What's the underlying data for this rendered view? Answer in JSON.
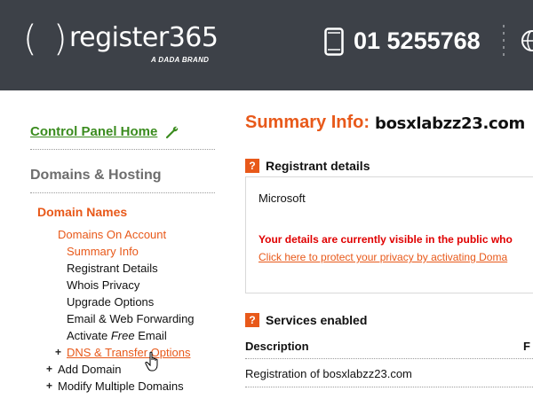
{
  "header": {
    "logo": {
      "open_paren": "(",
      "close_paren": ")",
      "name": "register365",
      "tagline": "A DADA BRAND"
    },
    "phone_icon": "phone-icon",
    "phone_number": "01 5255768",
    "globe_icon": "globe-icon",
    "bg_color": "#3d4148"
  },
  "sidebar": {
    "control_panel_home": "Control Panel Home",
    "wrench_icon": "wrench-icon",
    "domains_hosting": "Domains & Hosting",
    "domain_names": "Domain Names",
    "domains_on_account": "Domains On Account",
    "items": [
      {
        "label": "Summary Info"
      },
      {
        "label": "Registrant Details"
      },
      {
        "label": "Whois Privacy"
      },
      {
        "label": "Upgrade Options"
      },
      {
        "label": "Email & Web Forwarding"
      },
      {
        "label_pre": "Activate ",
        "label_em": "Free",
        "label_post": " Email"
      }
    ],
    "dns_transfer": "DNS & Transfer Options",
    "add_domain": "Add Domain",
    "modify_multiple": "Modify Multiple Domains",
    "expand_symbol": "+",
    "cursor_icon": "hand-cursor-icon",
    "colors": {
      "green": "#3b8c1f",
      "orange": "#e8591a",
      "gray": "#6d6d6d"
    }
  },
  "main": {
    "summary_label": "Summary Info:",
    "domain": "bosxlabzz23.com",
    "help_symbol": "?",
    "registrant": {
      "title": "Registrant details",
      "name": "Microsoft",
      "warning": "Your details are currently visible in the public who",
      "privacy_link": "Click here to protect your privacy by activating Doma"
    },
    "services": {
      "title": "Services enabled",
      "col_description": "Description",
      "col_second": "F",
      "row": "Registration of bosxlabzz23.com"
    },
    "colors": {
      "red": "#e00000"
    }
  }
}
